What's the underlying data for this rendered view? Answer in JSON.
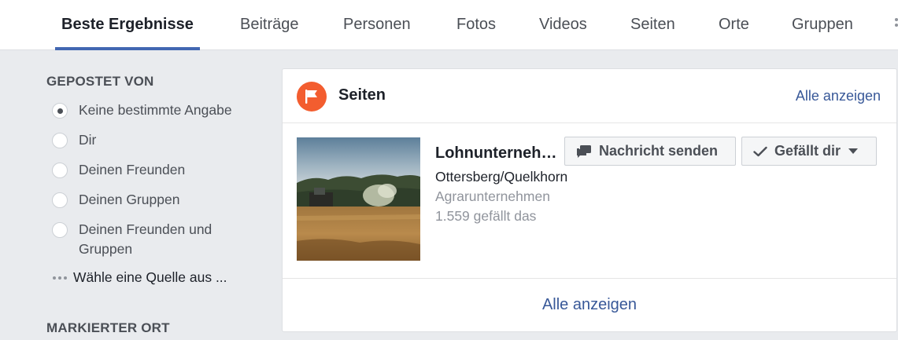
{
  "tabs": [
    {
      "label": "Beste Ergebnisse",
      "active": true
    },
    {
      "label": "Beiträge"
    },
    {
      "label": "Personen"
    },
    {
      "label": "Fotos"
    },
    {
      "label": "Videos"
    },
    {
      "label": "Seiten"
    },
    {
      "label": "Orte"
    },
    {
      "label": "Gruppen"
    }
  ],
  "filters": {
    "posted_by": {
      "heading": "GEPOSTET VON",
      "options": [
        {
          "label": "Keine bestimmte Angabe",
          "checked": true
        },
        {
          "label": "Dir",
          "checked": false
        },
        {
          "label": "Deinen Freunden",
          "checked": false
        },
        {
          "label": "Deinen Gruppen",
          "checked": false
        },
        {
          "label": "Deinen Freunden und Gruppen",
          "checked": false
        }
      ],
      "choose_source": "Wähle eine Quelle aus ..."
    },
    "tagged_location": {
      "heading": "MARKIERTER ORT"
    }
  },
  "pages_card": {
    "title": "Seiten",
    "see_all_header": "Alle anzeigen",
    "result": {
      "name": "Lohnunternehmen",
      "location": "Ottersberg/Quelkhorn",
      "category": "Agrarunternehmen",
      "likes": "1.559 gefällt das"
    },
    "message_button": "Nachricht senden",
    "like_button": "Gefällt dir",
    "see_all_footer": "Alle anzeigen"
  },
  "colors": {
    "accent": "#4267b2",
    "link": "#385898",
    "pages_badge": "#f35d2f",
    "background": "#e9ebee"
  },
  "icons": [
    "flag-icon",
    "message-icon",
    "checkmark-icon",
    "caret-down-icon",
    "more-dots-icon"
  ]
}
